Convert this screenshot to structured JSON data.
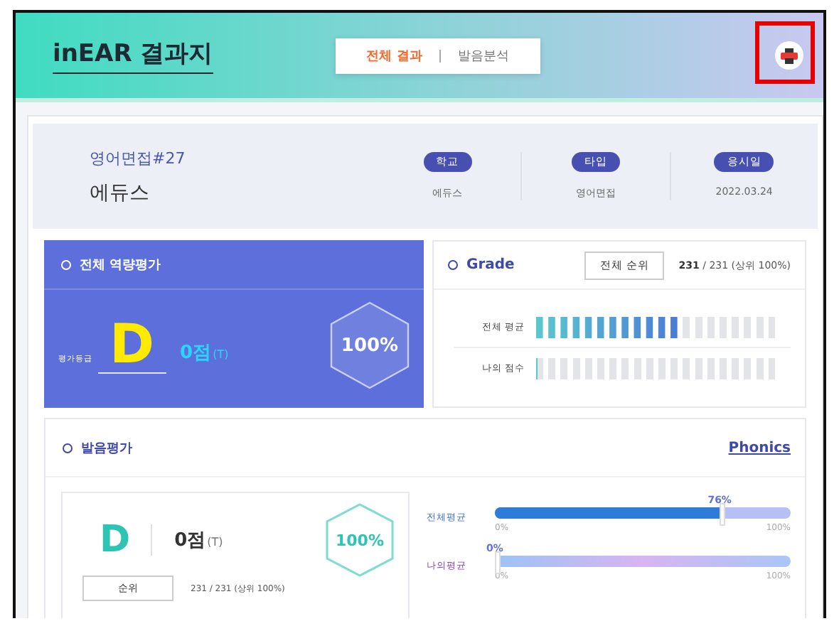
{
  "header": {
    "title": "inEAR 결과지",
    "tabs": [
      {
        "label": "전체 결과",
        "selected": true
      },
      {
        "label": "발음분석",
        "selected": false
      }
    ],
    "print_highlighted": true
  },
  "profile": {
    "test_name": "영어면접#27",
    "org_name": "에듀스",
    "fields": [
      {
        "label": "학교",
        "value": "에듀스"
      },
      {
        "label": "타입",
        "value": "영어면접"
      },
      {
        "label": "응시일",
        "value": "2022.03.24"
      }
    ]
  },
  "overall": {
    "title": "전체 역량평가",
    "grade_label": "평가등급",
    "grade": "D",
    "score": "0점",
    "score_suffix": "(T)",
    "percent": "100%"
  },
  "grade_panel": {
    "title": "Grade",
    "rank_button": "전체 순위",
    "rank_strong": "231",
    "rank_rest": "/ 231 (상위 100%)",
    "rows": [
      {
        "label": "전체 평균",
        "level": 0.6
      },
      {
        "label": "나의 점수",
        "level": 0
      }
    ]
  },
  "pronunciation": {
    "title": "발음평가",
    "link": "Phonics",
    "grade": "D",
    "score": "0점",
    "score_suffix": "(T)",
    "percent": "100%",
    "rank_button": "순위",
    "rank_text": "231 / 231 (상위 100%)",
    "bars": [
      {
        "label": "전체평균",
        "value": "76%",
        "level": 0.76,
        "min": "0%",
        "max": "100%"
      },
      {
        "label": "나의평균",
        "value": "0%",
        "level": 0,
        "min": "0%",
        "max": "100%"
      }
    ]
  }
}
